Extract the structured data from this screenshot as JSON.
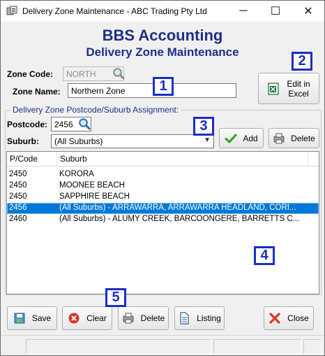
{
  "window": {
    "title": "Delivery Zone Maintenance - ABC Trading Pty Ltd",
    "minimize_glyph": "─",
    "maximize_glyph": "☐",
    "close_glyph": "✕"
  },
  "header": {
    "title": "BBS Accounting",
    "subtitle": "Delivery Zone Maintenance"
  },
  "form": {
    "zone_code_label": "Zone Code:",
    "zone_code_value": "NORTH",
    "zone_name_label": "Zone Name:",
    "zone_name_value": "Northern Zone",
    "edit_in_excel_line1": "Edit in",
    "edit_in_excel_line2": "Excel"
  },
  "assignment": {
    "group_title": "Delivery Zone Postcode/Suburb Assignment:",
    "postcode_label": "Postcode:",
    "postcode_value": "2456",
    "suburb_label": "Suburb:",
    "suburb_selected": "(All Suburbs)",
    "add_label": "Add",
    "delete_label": "Delete",
    "columns": [
      "P/Code",
      "Suburb"
    ],
    "rows": [
      {
        "pcode": "2450",
        "suburb": "KORORA",
        "selected": false
      },
      {
        "pcode": "2450",
        "suburb": "MOONEE BEACH",
        "selected": false
      },
      {
        "pcode": "2450",
        "suburb": "SAPPHIRE BEACH",
        "selected": false
      },
      {
        "pcode": "2456",
        "suburb": "(All Suburbs) - ARRAWARRA, ARRAWARRA HEADLAND, CORI...",
        "selected": true
      },
      {
        "pcode": "2460",
        "suburb": "(All Suburbs) - ALUMY CREEK, BARCOONGERE, BARRETTS C...",
        "selected": false
      }
    ]
  },
  "toolbar": {
    "save_label": "Save",
    "clear_label": "Clear",
    "delete_label": "Delete",
    "listing_label": "Listing",
    "close_label": "Close"
  },
  "markers": [
    "1",
    "2",
    "3",
    "4",
    "5"
  ],
  "colors": {
    "heading": "#1c2f8a",
    "marker": "#1a2fc9",
    "selection": "#0078d7"
  },
  "icons": {
    "app": "app-icon",
    "lookup": "magnifier-icon",
    "excel": "excel-icon",
    "add": "checkmark-icon",
    "delete": "printer-delete-icon",
    "save": "save-icon",
    "clear": "clear-icon",
    "listing": "document-icon",
    "close": "close-x-icon"
  }
}
